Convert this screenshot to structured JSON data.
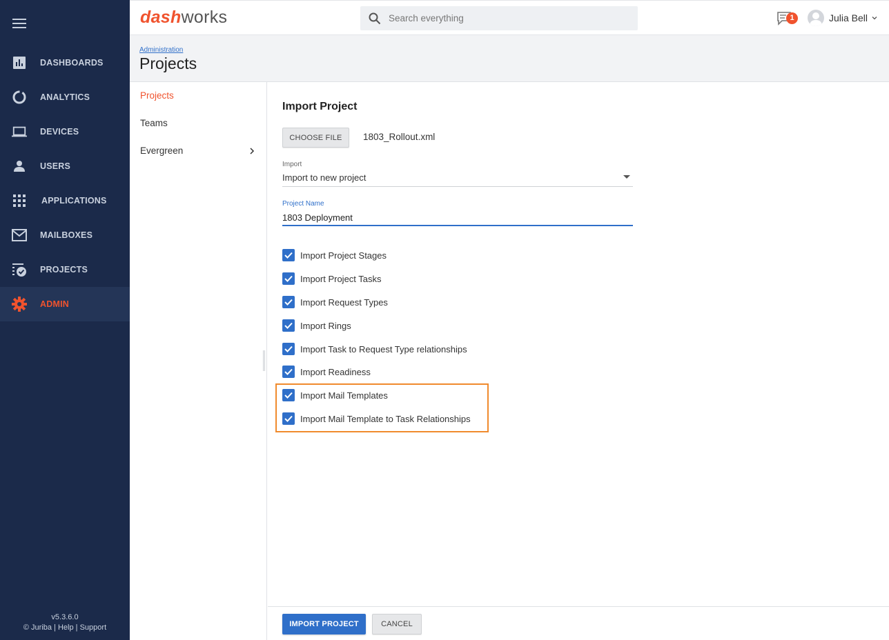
{
  "brand": {
    "logo_dash": "dash",
    "logo_works": "works",
    "accent": "#f0532e",
    "primary": "#2f6fc9",
    "sidebar_bg": "#1b2a4a"
  },
  "sidebar": {
    "items": [
      {
        "label": "DASHBOARDS",
        "icon": "bar-chart-icon"
      },
      {
        "label": "ANALYTICS",
        "icon": "donut-icon"
      },
      {
        "label": "DEVICES",
        "icon": "laptop-icon"
      },
      {
        "label": "USERS",
        "icon": "person-icon"
      },
      {
        "label": "APPLICATIONS",
        "icon": "grid-icon"
      },
      {
        "label": "MAILBOXES",
        "icon": "mail-icon"
      },
      {
        "label": "PROJECTS",
        "icon": "project-icon"
      },
      {
        "label": "ADMIN",
        "icon": "gear-icon",
        "active": true
      }
    ],
    "version": "v5.3.6.0",
    "footer": {
      "copyright": "© Juriba",
      "help": "Help",
      "support": "Support",
      "sep": "|"
    }
  },
  "header": {
    "search_placeholder": "Search everything",
    "notifications": "1",
    "user_name": "Julia Bell"
  },
  "page": {
    "breadcrumb": "Administration",
    "title": "Projects"
  },
  "subnav": {
    "items": [
      "Projects",
      "Teams",
      "Evergreen"
    ]
  },
  "form": {
    "title": "Import Project",
    "choose_file": "CHOOSE FILE",
    "file_name": "1803_Rollout.xml",
    "import_label": "Import",
    "import_value": "Import to new project",
    "name_label": "Project Name",
    "name_value": "1803 Deployment",
    "checks": [
      "Import Project Stages",
      "Import Project Tasks",
      "Import Request Types",
      "Import Rings",
      "Import Task to Request Type relationships",
      "Import Readiness",
      "Import Mail Templates",
      "Import Mail Template to Task Relationships"
    ]
  },
  "footer": {
    "import_btn": "IMPORT PROJECT",
    "cancel_btn": "CANCEL"
  }
}
